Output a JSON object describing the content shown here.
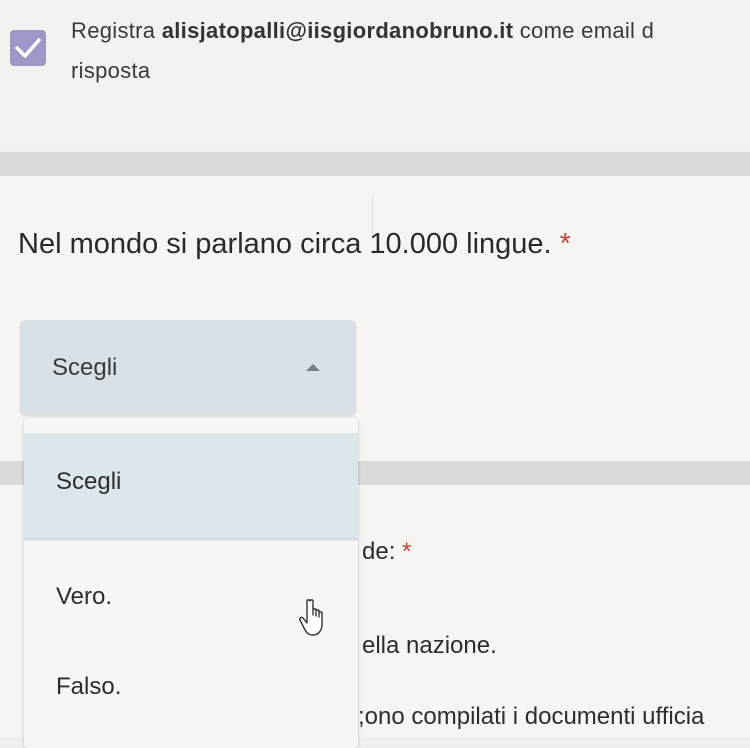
{
  "email_confirm": {
    "prefix": "Registra ",
    "email": "alisjatopalli@iisgiordanobruno.it",
    "suffix": " come email d",
    "line2": "risposta",
    "checked": true
  },
  "question": {
    "title": "Nel mondo si parlano circa 10.000 lingue.",
    "required_mark": "*"
  },
  "dropdown": {
    "selected_label": "Scegli",
    "options": [
      "Scegli",
      "Vero.",
      "Falso."
    ]
  },
  "next_question_partial": {
    "line1": "de:",
    "required_mark": "*",
    "line2": "ella nazione.",
    "line3": ";ono compilati i documenti ufficia"
  },
  "colors": {
    "checkbox": "#9e98c8",
    "accent_required": "#c2463c",
    "dropdown_bg": "#d9e0e6",
    "selected_option_bg": "#dde6ea"
  }
}
